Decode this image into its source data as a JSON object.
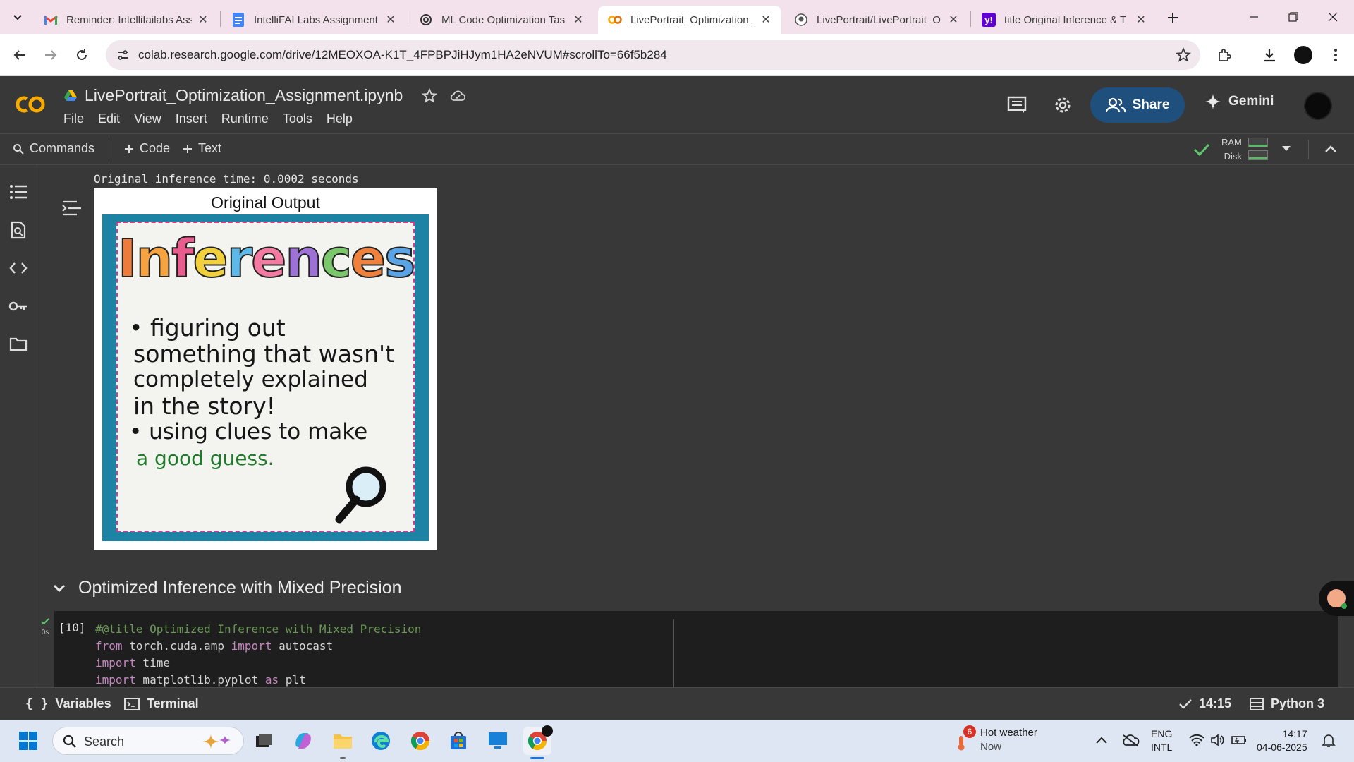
{
  "browser": {
    "tabs": [
      {
        "title": "Reminder: Intellifailabs Ass",
        "icon": "gmail-icon"
      },
      {
        "title": "IntelliFAI Labs Assignment",
        "icon": "docs-icon"
      },
      {
        "title": "ML Code Optimization Tas",
        "icon": "chatgpt-icon"
      },
      {
        "title": "LivePortrait_Optimization_",
        "icon": "colab-icon",
        "active": true
      },
      {
        "title": "LivePortrait/LivePortrait_O",
        "icon": "github-icon"
      },
      {
        "title": "title Original Inference & T",
        "icon": "yahoo-icon"
      }
    ],
    "url": "colab.research.google.com/drive/12MEOXOA-K1T_4FPBPJiHJym1HA2eNVUM#scrollTo=66f5b284"
  },
  "colab": {
    "notebook_title": "LivePortrait_Optimization_Assignment.ipynb",
    "menu": [
      "File",
      "Edit",
      "View",
      "Insert",
      "Runtime",
      "Tools",
      "Help"
    ],
    "share_label": "Share",
    "gemini_label": "Gemini",
    "toolbar": {
      "commands": "Commands",
      "code": "Code",
      "text": "Text",
      "ram": "RAM",
      "disk": "Disk"
    },
    "output": {
      "time_line": "Original inference time: 0.0002 seconds",
      "figure_title": "Original Output",
      "image_text": {
        "word": "Inferences",
        "lines": [
          "figuring out",
          "something that wasn't",
          "completely explained",
          "in the story!",
          "using clues to make",
          "a good guess."
        ]
      }
    },
    "section_title": "Optimized Inference with Mixed Precision",
    "cell": {
      "exec_count": "[10]",
      "exec_time": "0s",
      "code_lines": [
        {
          "parts": [
            {
              "t": "#@title Optimized Inference with Mixed Precision",
              "c": "cm"
            }
          ]
        },
        {
          "parts": [
            {
              "t": "from",
              "c": "kw"
            },
            {
              "t": " torch.cuda.amp ",
              "c": ""
            },
            {
              "t": "import",
              "c": "kw"
            },
            {
              "t": " autocast",
              "c": ""
            }
          ]
        },
        {
          "parts": [
            {
              "t": "import",
              "c": "kw"
            },
            {
              "t": " time",
              "c": ""
            }
          ]
        },
        {
          "parts": [
            {
              "t": "import",
              "c": "kw"
            },
            {
              "t": " matplotlib.pyplot ",
              "c": ""
            },
            {
              "t": "as",
              "c": "kw"
            },
            {
              "t": " plt",
              "c": ""
            }
          ]
        }
      ]
    },
    "status": {
      "variables": "Variables",
      "terminal": "Terminal",
      "time": "14:15",
      "runtime": "Python 3"
    }
  },
  "taskbar": {
    "search_placeholder": "Search",
    "weather_badge": "6",
    "weather_title": "Hot weather",
    "weather_sub": "Now",
    "lang1": "ENG",
    "lang2": "INTL",
    "time": "14:17",
    "date": "04-06-2025"
  },
  "colors": {
    "colab_bg": "#383838",
    "share_blue": "#1e4f7d",
    "colab_orange": "#f9ab00",
    "tab_strip": "#f3e1ec"
  }
}
